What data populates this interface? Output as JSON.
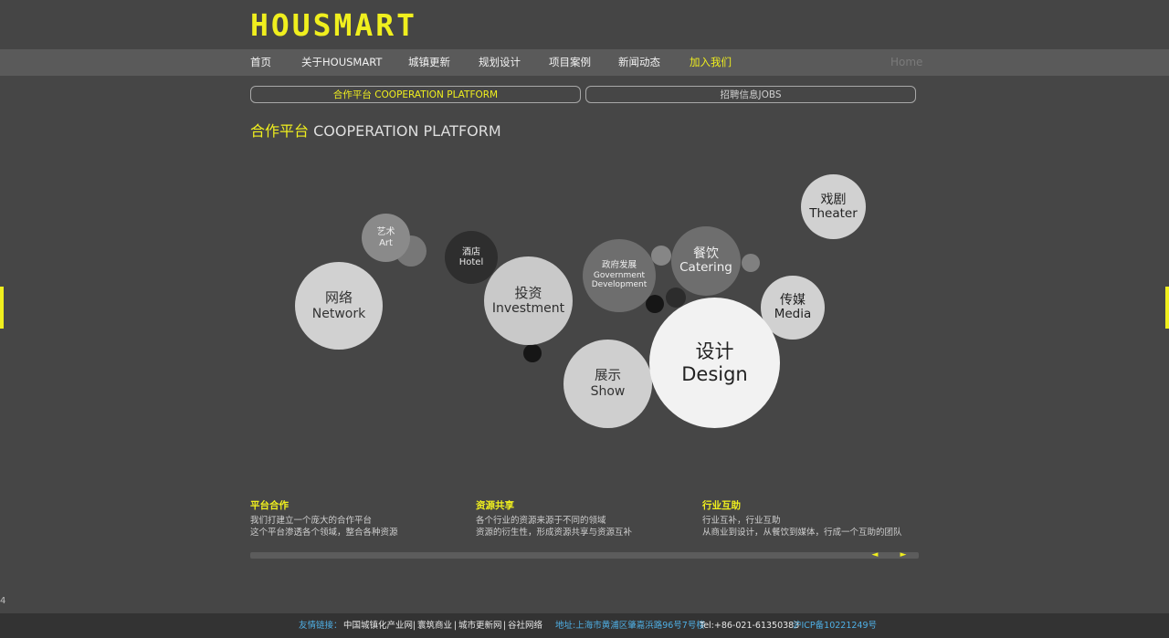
{
  "brand": {
    "logo_text": "HOUSMART"
  },
  "nav": {
    "items": [
      {
        "label": "首页"
      },
      {
        "label": "关于HOUSMART"
      },
      {
        "label": "城镇更新"
      },
      {
        "label": "规划设计"
      },
      {
        "label": "项目案例"
      },
      {
        "label": "新闻动态"
      },
      {
        "label": "加入我们",
        "active": true
      }
    ],
    "home_label": "Home"
  },
  "subtabs": [
    {
      "label": "合作平台 COOPERATION PLATFORM",
      "active": true
    },
    {
      "label": "招聘信息JOBS",
      "active": false
    }
  ],
  "page_title": {
    "zh": "合作平台",
    "en": " COOPERATION PLATFORM"
  },
  "bubbles": [
    {
      "zh": "网络",
      "en": "Network"
    },
    {
      "zh": "艺术",
      "en": "Art"
    },
    {
      "zh": "酒店",
      "en": "Hotel"
    },
    {
      "zh": "投资",
      "en": "Investment"
    },
    {
      "zh": "政府发展",
      "en": "Government Development"
    },
    {
      "zh": "餐饮",
      "en": "Catering"
    },
    {
      "zh": "戏剧",
      "en": "Theater"
    },
    {
      "zh": "传媒",
      "en": "Media"
    },
    {
      "zh": "展示",
      "en": "Show"
    },
    {
      "zh": "设计",
      "en": "Design"
    }
  ],
  "features": [
    {
      "title": "平台合作",
      "lines": [
        "我们打建立一个庞大的合作平台",
        "这个平台渗透各个领域，整合各种资源"
      ]
    },
    {
      "title": "资源共享",
      "lines": [
        "各个行业的资源来源于不同的领域",
        "资源的衍生性，形成资源共享与资源互补"
      ]
    },
    {
      "title": "行业互助",
      "lines": [
        "行业互补，行业互助",
        "从商业到设计，从餐饮到媒体，行成一个互助的团队"
      ]
    }
  ],
  "slider": {
    "prev_icon": "arrow-left-icon",
    "next_icon": "arrow-right-icon",
    "prev_glyph": "◄",
    "next_glyph": "►"
  },
  "stray_text": "4",
  "footer": {
    "links_label": "友情链接：",
    "links": [
      "中国城镇化产业网",
      "寰筑商业",
      "城市更新网",
      "谷社网络"
    ],
    "separator": "|",
    "address": "地址:上海市黄浦区肇嘉浜路96号7号楼",
    "tel": "Tel:+86-021-61350383",
    "icp": "沪ICP备10221249号"
  },
  "colors": {
    "accent": "#f0ef1e",
    "background": "#464646",
    "nav_bg": "#5a5a5a",
    "footer_bg": "#333333",
    "link_blue": "#4fb0e6"
  }
}
